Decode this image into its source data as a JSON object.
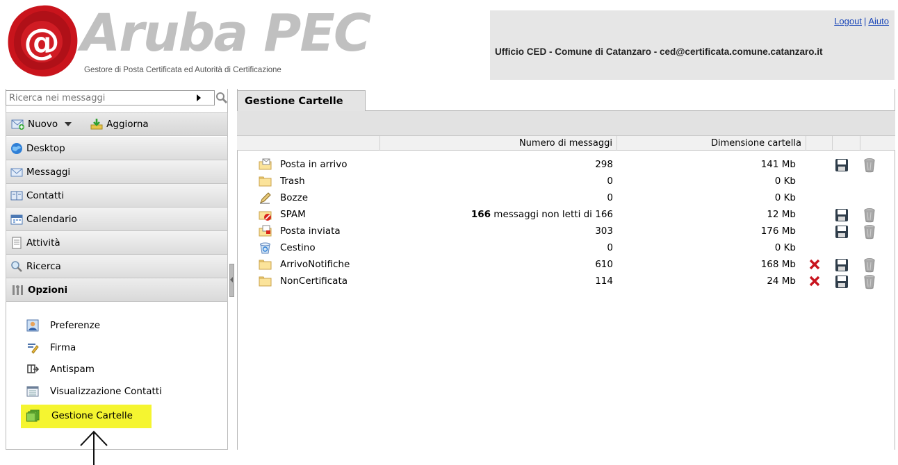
{
  "header": {
    "logo_text": "Aruba PEC",
    "logo_seal_text": "@",
    "tagline": "Gestore di Posta Certificata ed Autorità di Certificazione",
    "logout_label": "Logout",
    "separator": "|",
    "help_label": "Aiuto",
    "user_info": "Ufficio CED - Comune di Catanzaro - ced@certificata.comune.catanzaro.it"
  },
  "sidebar": {
    "search_placeholder": "Ricerca nei messaggi",
    "toolbar": {
      "new_label": "Nuovo",
      "refresh_label": "Aggiorna"
    },
    "nav": [
      {
        "label": "Desktop",
        "icon": "globe-icon"
      },
      {
        "label": "Messaggi",
        "icon": "envelope-icon"
      },
      {
        "label": "Contatti",
        "icon": "address-book-icon"
      },
      {
        "label": "Calendario",
        "icon": "calendar-icon"
      },
      {
        "label": "Attività",
        "icon": "task-list-icon"
      },
      {
        "label": "Ricerca",
        "icon": "magnifier-icon"
      },
      {
        "label": "Opzioni",
        "icon": "tools-icon",
        "active": true
      }
    ],
    "options": [
      {
        "label": "Preferenze",
        "icon": "user-profile-icon"
      },
      {
        "label": "Firma",
        "icon": "signature-pen-icon"
      },
      {
        "label": "Antispam",
        "icon": "antispam-filter-icon"
      },
      {
        "label": "Visualizzazione Contatti",
        "icon": "contacts-view-icon"
      },
      {
        "label": "Gestione Cartelle",
        "icon": "folders-stack-icon",
        "highlighted": true
      }
    ],
    "highlight_color": "#f5f530"
  },
  "main": {
    "tab_label": "Gestione Cartelle",
    "columns": [
      "",
      "Numero di messaggi",
      "Dimensione cartella",
      "",
      "",
      ""
    ],
    "folders": [
      {
        "name": "Posta in arrivo",
        "icon": "inbox-folder-icon",
        "count_bold": "",
        "count": "298",
        "size": "141 Mb",
        "delete": false,
        "save": true,
        "trash": true
      },
      {
        "name": "Trash",
        "icon": "folder-icon",
        "count_bold": "",
        "count": "0",
        "size": "0 Kb",
        "delete": false,
        "save": false,
        "trash": false
      },
      {
        "name": "Bozze",
        "icon": "drafts-pencil-icon",
        "count_bold": "",
        "count": "0",
        "size": "0 Kb",
        "delete": false,
        "save": false,
        "trash": false
      },
      {
        "name": "SPAM",
        "icon": "spam-folder-icon",
        "count_bold": "166",
        "count": " messaggi non letti di 166",
        "size": "12 Mb",
        "delete": false,
        "save": true,
        "trash": true
      },
      {
        "name": "Posta inviata",
        "icon": "sent-folder-icon",
        "count_bold": "",
        "count": "303",
        "size": "176 Mb",
        "delete": false,
        "save": true,
        "trash": true
      },
      {
        "name": "Cestino",
        "icon": "recycle-bin-icon",
        "count_bold": "",
        "count": "0",
        "size": "0 Kb",
        "delete": false,
        "save": false,
        "trash": false
      },
      {
        "name": "ArrivoNotifiche",
        "icon": "folder-icon",
        "count_bold": "",
        "count": "610",
        "size": "168 Mb",
        "delete": true,
        "save": true,
        "trash": true
      },
      {
        "name": "NonCertificata",
        "icon": "folder-icon",
        "count_bold": "",
        "count": "114",
        "size": "24 Mb",
        "delete": true,
        "save": true,
        "trash": true
      }
    ]
  },
  "colors": {
    "link": "#1a46b8",
    "delete_x": "#c8141e",
    "brand_red": "#cc1a1a"
  }
}
